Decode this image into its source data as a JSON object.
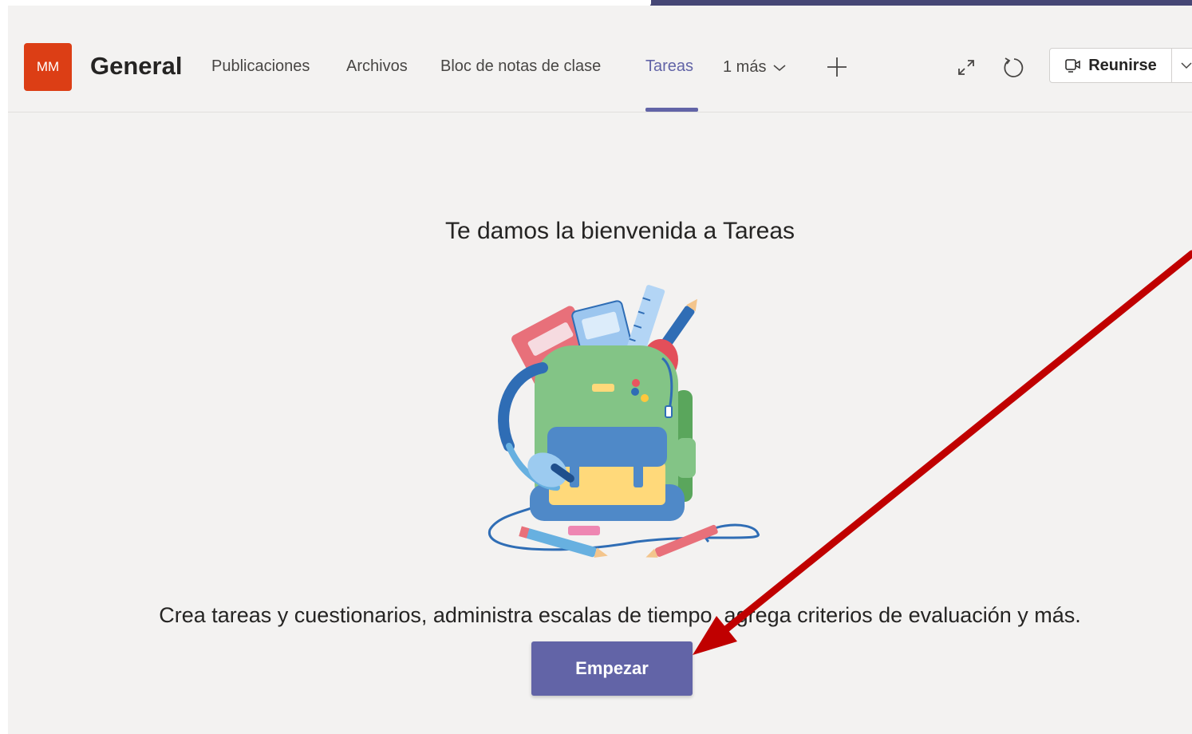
{
  "header": {
    "avatar_initials": "MM",
    "channel_name": "General",
    "tabs": [
      {
        "label": "Publicaciones"
      },
      {
        "label": "Archivos"
      },
      {
        "label": "Bloc de notas de clase"
      },
      {
        "label": "Tareas",
        "active": true
      }
    ],
    "more_tabs_label": "1 más",
    "add_tab_icon": "plus-icon",
    "expand_icon": "expand-icon",
    "refresh_icon": "refresh-icon",
    "meet_label": "Reunirse",
    "meet_icon": "video-camera-icon"
  },
  "main": {
    "welcome_title": "Te damos la bienvenida a Tareas",
    "illustration_icon": "backpack-illustration",
    "description": "Crea tareas y cuestionarios, administra escalas de tiempo, agrega criterios de evaluación y más.",
    "start_button_label": "Empezar"
  },
  "colors": {
    "brand": "#6264a7",
    "top_bar": "#464775",
    "avatar": "#dc3e15",
    "annotation_arrow": "#c00000"
  }
}
